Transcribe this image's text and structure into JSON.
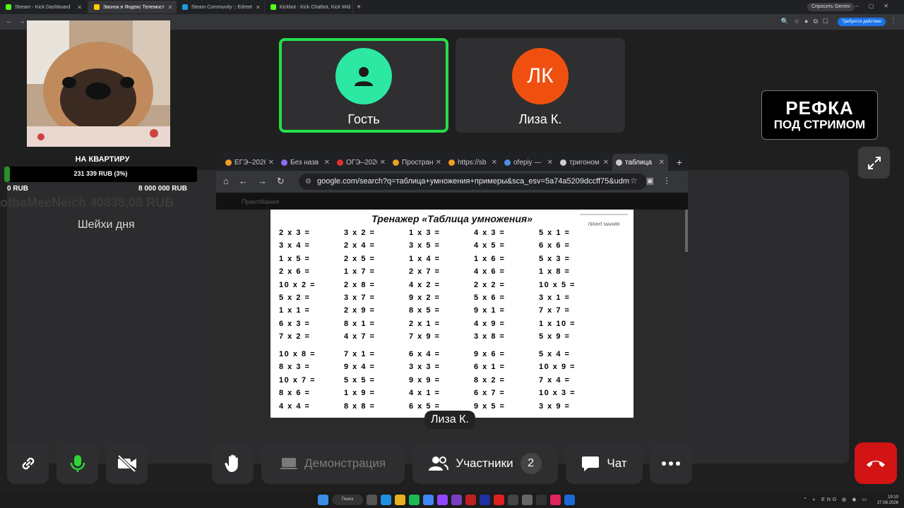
{
  "outer_browser": {
    "tabs": [
      {
        "title": "Stream - Kick Dashboard",
        "color": "#53fc18",
        "active": false
      },
      {
        "title": "Звонок в Яндекс Телемост",
        "color": "#ffcc00",
        "active": true
      },
      {
        "title": "Steam Community :: Edreet",
        "color": "#1b9bd8",
        "active": false
      },
      {
        "title": "Kickbot - Kick Chatbot, Kick Wid",
        "color": "#53fc18",
        "active": false
      }
    ],
    "gemini_label": "Спросить Gemini",
    "profile_label": "Требуется действие"
  },
  "participants": [
    {
      "name": "Гость",
      "initials": "",
      "color": "#2de8a2",
      "speaking": true
    },
    {
      "name": "Лиза К.",
      "initials": "ЛК",
      "color": "#f0500f",
      "speaking": false
    }
  ],
  "overlay": {
    "goal_title": "НА КВАРТИРУ",
    "goal_amount": "231 339 RUB (3%)",
    "goal_progress": 0.03,
    "goal_min": "0 RUB",
    "goal_max": "8 000 000 RUB",
    "ghost_text": "otbaMeeNeich 40838,08 RUB",
    "subtitle": "Шейхи дня",
    "refka_line1": "РЕФКА",
    "refka_line2": "ПОД СТРИМОМ"
  },
  "shared_screen": {
    "tabs": [
      {
        "title": "ЕГЭ–2026",
        "color": "#f0a020"
      },
      {
        "title": "Без назв",
        "color": "#8a6cf0"
      },
      {
        "title": "ОГЭ–2026",
        "color": "#e03030"
      },
      {
        "title": "Простран",
        "color": "#f0a020"
      },
      {
        "title": "https://sb",
        "color": "#f0a020"
      },
      {
        "title": "ofepiy —",
        "color": "#4a90e2"
      },
      {
        "title": "тригоном",
        "color": "#cccccc"
      },
      {
        "title": "таблица",
        "color": "#cccccc",
        "active": true
      }
    ],
    "url": "google.com/search?q=таблица+умножения+примеры&sca_esv=5a74a5209dccff75&udm",
    "strip_text": "ПринтМания",
    "sheet_title": "Тренажер «Таблица умножения»",
    "sheet_logo": "ПРИНТ МАНИЯ",
    "block1": [
      [
        "2 x 3 =",
        "3 x 2 =",
        "1 x 3 =",
        "4 x 3 =",
        "5 x 1 ="
      ],
      [
        "3 x 4 =",
        "2 x 4 =",
        "3 x 5 =",
        "4 x 5 =",
        "6 x 6 ="
      ],
      [
        "1 x 5 =",
        "2 x 5 =",
        "1 x 4 =",
        "1 x 6 =",
        "5 x 3 ="
      ],
      [
        "2 x 6 =",
        "1 x 7 =",
        "2 x 7 =",
        "4 x 6 =",
        "1 x 8 ="
      ],
      [
        "10 x 2 =",
        "2 x 8 =",
        "4 x 2 =",
        "2 x 2 =",
        "10 x 5 ="
      ],
      [
        "5 x 2 =",
        "3 x 7 =",
        "9 x 2 =",
        "5 x 6 =",
        "3 x 1 ="
      ],
      [
        "1 x 1 =",
        "2 x 9 =",
        "8 x 5 =",
        "9 x 1 =",
        "7 x 7 ="
      ],
      [
        "6 x 3 =",
        "8 x 1 =",
        "2 x 1 =",
        "4 x 9 =",
        "1 x 10 ="
      ],
      [
        "7 x 2 =",
        "4 x 7 =",
        "7 x 9 =",
        "3 x 8 =",
        "5 x 9 ="
      ]
    ],
    "block2": [
      [
        "10 x 8 =",
        "7 x 1 =",
        "6 x 4 =",
        "9 x 6 =",
        "5 x 4 ="
      ],
      [
        "8 x 3 =",
        "9 x 4 =",
        "3 x 3 =",
        "6 x 1 =",
        "10 x 9 ="
      ],
      [
        "10 x 7 =",
        "5 x 5 =",
        "9 x 9 =",
        "8 x 2 =",
        "7 x 4 ="
      ],
      [
        "8 x 6 =",
        "1 x 9 =",
        "4 x 1 =",
        "6 x 7 =",
        "10 x 3 ="
      ],
      [
        "4 x 4 =",
        "8 x 8 =",
        "6 x 5 =",
        "9 x 5 =",
        "3 x 9 ="
      ]
    ]
  },
  "speaker_label": "Лиза К.",
  "controls": {
    "demo_label": "Демонстрация",
    "participants_label": "Участники",
    "participants_count": "2",
    "chat_label": "Чат"
  },
  "taskbar": {
    "search_label": "Поиск",
    "lang": "ENG",
    "time": "19:10",
    "date": "27.08.2026"
  }
}
